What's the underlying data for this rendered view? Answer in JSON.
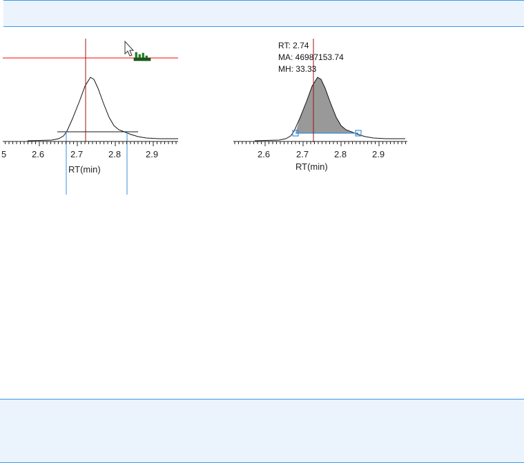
{
  "left_chart": {
    "x_label": "RT(min)",
    "tick_labels": [
      "5",
      "2.6",
      "2.7",
      "2.8",
      "2.9"
    ]
  },
  "right_chart": {
    "x_label": "RT(min)",
    "tick_labels": [
      "2.6",
      "2.7",
      "2.8",
      "2.9"
    ],
    "annotation": {
      "rt": "RT: 2.74",
      "ma": "MA: 46987153.74",
      "mh": "MH: 33.33"
    }
  },
  "colors": {
    "crosshair": "#ff0000",
    "cursor_line": "#a01010",
    "integration_marker": "#3a8fd8",
    "peak_fill": "#999999",
    "panel_border": "#3a97e8",
    "panel_bg": "#ebf3fc"
  },
  "icons": [
    "pointer-cursor-icon",
    "peak-tool-icon"
  ]
}
